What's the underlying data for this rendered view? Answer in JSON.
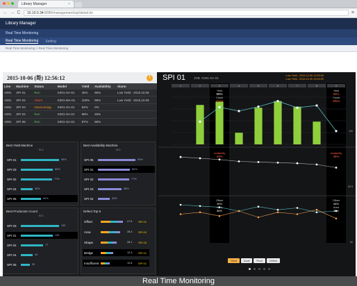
{
  "browser": {
    "tab_title": "Library Manager",
    "tab_close": "×",
    "url_host": "10.10.0.34",
    "url_path": ":8080/management/spi/detail.do",
    "back": "←",
    "forward": "→",
    "reload": "C",
    "menu": "≡"
  },
  "app": {
    "title": "Library Manager",
    "nav_item": "Real Time Monitoring",
    "subnav": [
      "Real Time Monitoring",
      "Setting"
    ],
    "breadcrumb": "Real Time Monitoring > Real Time Monitoring"
  },
  "status": {
    "datetime": "2015-10-06 (화) 12:56:12",
    "alarm_icon": "!"
  },
  "machine_table": {
    "headers": [
      "Line",
      "Machine",
      "Status",
      "Model",
      "Yield",
      "Availability",
      "Alarm"
    ],
    "rows": [
      [
        "A001",
        "SPI 01",
        "Run",
        "K001-SA-01",
        "45%",
        "85%",
        "Low Yield - 2015.10.05"
      ],
      [
        "A001",
        "SPI 02",
        "Alarm",
        "K001-MA-01",
        "100%",
        "99%",
        "Low Yield - 2015.10.05"
      ],
      [
        "A001",
        "SPI 03",
        "Overcoming",
        "K001-SA-01",
        "92%",
        "0%",
        ""
      ],
      [
        "A001",
        "SPI 04",
        "Run",
        "K001-SA-01",
        "98%",
        "45%",
        ""
      ],
      [
        "A001",
        "SPI 05",
        "Run",
        "K001-SA-01",
        "97%",
        "96%",
        ""
      ]
    ],
    "status_colors": {
      "Run": "#5ac85a",
      "Alarm": "#ff5a3a",
      "Overcoming": "#ff9a1a"
    }
  },
  "panels": {
    "best_yield": {
      "title": "Best Yield Machine",
      "scale": "96.8",
      "items": [
        {
          "label": "SPI 01",
          "value": "95%",
          "fraction": 0.95,
          "highlight": false
        },
        {
          "label": "SPI 03",
          "value": "80%",
          "fraction": 0.8,
          "highlight": false
        },
        {
          "label": "SPI 02",
          "value": "77%",
          "fraction": 0.77,
          "highlight": false
        },
        {
          "label": "SPI 04",
          "value": "30%",
          "fraction": 0.3,
          "highlight": false
        },
        {
          "label": "SPI 05",
          "value": "50%",
          "fraction": 0.5,
          "highlight": true
        }
      ]
    },
    "best_availability": {
      "title": "Best Availability Machine",
      "scale": "96.8",
      "items": [
        {
          "label": "SPI 05",
          "value": "93%",
          "fraction": 0.93,
          "highlight": false
        },
        {
          "label": "SPI 01",
          "value": "80%",
          "fraction": 0.8,
          "highlight": true
        },
        {
          "label": "SPI 02",
          "value": "77%",
          "fraction": 0.77,
          "highlight": false
        },
        {
          "label": "SPI 03",
          "value": "58%",
          "fraction": 0.58,
          "highlight": false
        },
        {
          "label": "SPI 04",
          "value": "30%",
          "fraction": 0.3,
          "highlight": false
        }
      ]
    },
    "best_production": {
      "title": "Best Production Count",
      "scale": "96.8",
      "items": [
        {
          "label": "SPI 03",
          "value": "130",
          "fraction": 0.95,
          "highlight": false
        },
        {
          "label": "SPI 01",
          "value": "105",
          "fraction": 0.8,
          "highlight": true
        },
        {
          "label": "SPI 02",
          "value": "77",
          "fraction": 0.55,
          "highlight": false
        },
        {
          "label": "SPI 04",
          "value": "40",
          "fraction": 0.3,
          "highlight": false
        },
        {
          "label": "SPI 05",
          "value": "30",
          "fraction": 0.22,
          "highlight": false
        }
      ]
    },
    "defect_top5": {
      "title": "Defect Top 5",
      "items": [
        {
          "label": "Offset",
          "value": "27.6",
          "machine": "SPI 01",
          "highlight": false
        },
        {
          "label": "Area",
          "value": "28.4",
          "machine": "SPI 02",
          "highlight": false
        },
        {
          "label": "Shape",
          "value": "26.1",
          "machine": "SPI 03",
          "highlight": false
        },
        {
          "label": "Bridge",
          "value": "12.3",
          "machine": "SPI 01",
          "highlight": true
        },
        {
          "label": "Insufficient",
          "value": "10.8",
          "machine": "SPI 01",
          "highlight": true
        }
      ]
    }
  },
  "spi_chart": {
    "title": "SPI 01",
    "job": "JOB",
    "job_name": "K001-SA-01",
    "warnings": [
      "Low Yield - 2015.10.05 13:00:00",
      "Low Yield - 2015.10.05 13:00:00"
    ],
    "hours": [
      "1",
      "2",
      "3",
      "4",
      "5",
      "6",
      "7",
      "8",
      "9"
    ],
    "colors": {
      "bar": "#8fcf3c",
      "line": "#5bc0c8",
      "line2": "#f0a050",
      "alert": "#ff5a3a",
      "highlight": "#000000"
    },
    "chart_data": {
      "type": "bar",
      "categories": [
        "1",
        "2",
        "3",
        "4",
        "5",
        "6",
        "7",
        "8",
        "9"
      ],
      "series": [
        {
          "name": "Yield",
          "values": [
            null,
            71,
            77,
            21,
            66,
            78,
            68,
            41,
            null
          ]
        },
        {
          "name": "Availability",
          "values": [
            null,
            41,
            67,
            60,
            68,
            78,
            66,
            70,
            24
          ]
        }
      ]
    },
    "top_highlights": [
      {
        "col": 2,
        "label1": "Yield",
        "value1": "80%",
        "label2": "Count",
        "value2": "21ea"
      },
      {
        "col": 8,
        "label1": "Yield",
        "value1": "55%",
        "label2": "Count",
        "value2": "38ea"
      }
    ],
    "mid_labels": [
      {
        "col": 2,
        "label": "Availability",
        "value": "33%"
      },
      {
        "col": 8,
        "label": "Availability",
        "value": "38%"
      }
    ],
    "bottom_labels": [
      {
        "col": 2,
        "lines": [
          "Offset",
          "90%",
          "Area",
          "86%"
        ]
      },
      {
        "col": 8,
        "lines": [
          "Offset",
          "65%",
          "Area",
          "85%"
        ]
      }
    ],
    "right_values": [
      "100",
      "82.5",
      "50"
    ],
    "pager": [
      "Yield",
      "Avail",
      "Prod",
      "Defect"
    ],
    "dots": 5
  },
  "caption": "Real Time Monitoring"
}
